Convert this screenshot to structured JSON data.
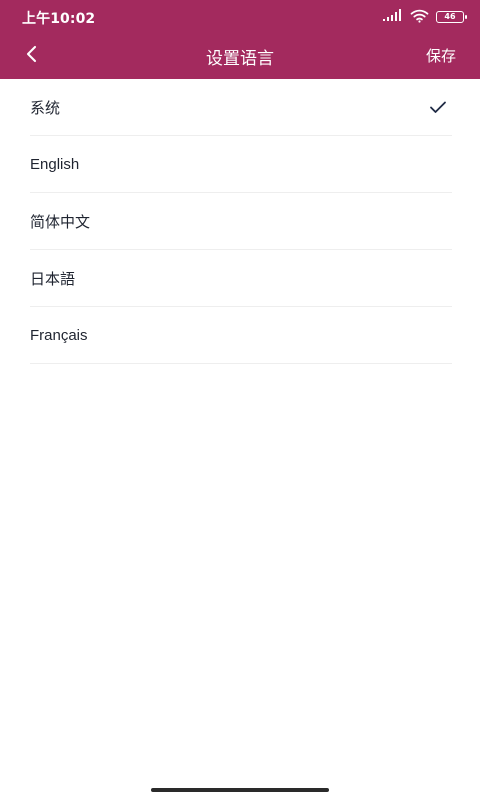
{
  "status": {
    "time": "上午10:02",
    "battery": "46",
    "icons": [
      "signal-icon",
      "wifi-icon",
      "battery-icon"
    ]
  },
  "header": {
    "title": "设置语言",
    "save_label": "保存",
    "back_icon": "chevron-left-icon"
  },
  "languages": [
    {
      "label": "系统",
      "selected": true
    },
    {
      "label": "English",
      "selected": false
    },
    {
      "label": "简体中文",
      "selected": false
    },
    {
      "label": "日本語",
      "selected": false
    },
    {
      "label": "Français",
      "selected": false
    }
  ],
  "colors": {
    "header_background": "#a32a5e",
    "selected_check": "#1f2a44",
    "divider": "#eeeeee"
  }
}
